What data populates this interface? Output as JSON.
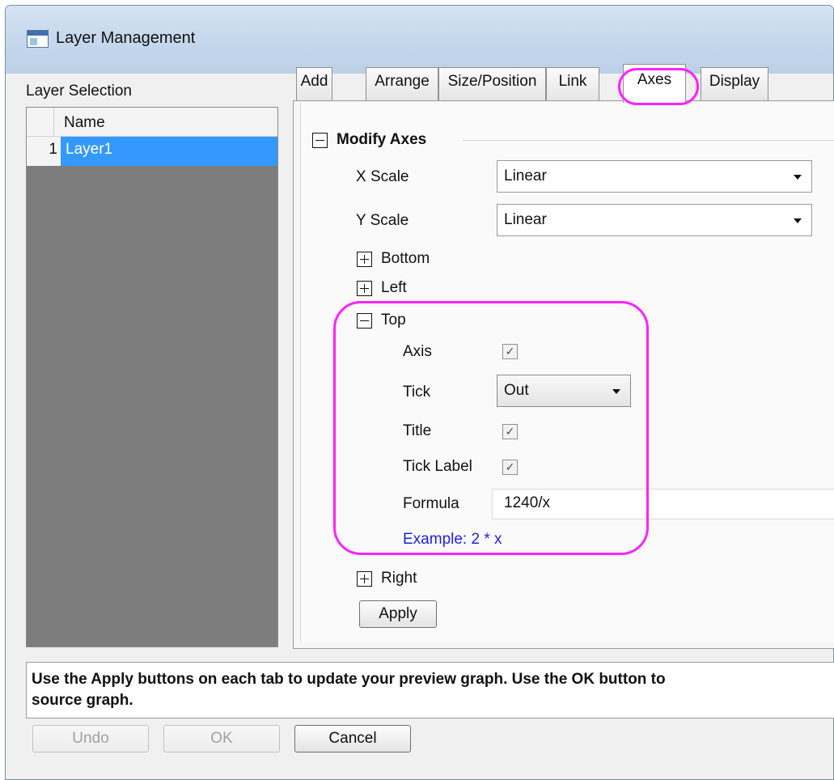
{
  "window": {
    "title": "Layer Management"
  },
  "layer_selection": {
    "label": "Layer Selection",
    "column_header": "Name",
    "rows": [
      {
        "index": "1",
        "name": "Layer1",
        "selected": true
      }
    ]
  },
  "tabs": [
    {
      "label": "Add",
      "active": false
    },
    {
      "label": "Arrange",
      "active": false
    },
    {
      "label": "Size/Position",
      "active": false
    },
    {
      "label": "Link",
      "active": false
    },
    {
      "label": "Axes",
      "active": true
    },
    {
      "label": "Display",
      "active": false
    }
  ],
  "axes_tab": {
    "group_title": "Modify Axes",
    "x_scale": {
      "label": "X Scale",
      "value": "Linear"
    },
    "y_scale": {
      "label": "Y Scale",
      "value": "Linear"
    },
    "sections": {
      "bottom": "Bottom",
      "left": "Left",
      "top": "Top",
      "right": "Right"
    },
    "top": {
      "axis": {
        "label": "Axis",
        "checked": true
      },
      "tick": {
        "label": "Tick",
        "value": "Out"
      },
      "title": {
        "label": "Title",
        "checked": true
      },
      "tick_label": {
        "label": "Tick Label",
        "checked": true
      },
      "formula": {
        "label": "Formula",
        "value": "1240/x"
      },
      "example": "Example: 2 * x"
    },
    "apply_label": "Apply"
  },
  "hint": "Use the Apply buttons on each tab to update your preview graph. Use the OK button to\nsource graph.",
  "footer": {
    "undo_label": "Undo",
    "ok_label": "OK",
    "cancel_label": "Cancel"
  },
  "colors": {
    "highlight": "#ff22ff",
    "selection": "#3399ff",
    "example_text": "#2222dd"
  }
}
